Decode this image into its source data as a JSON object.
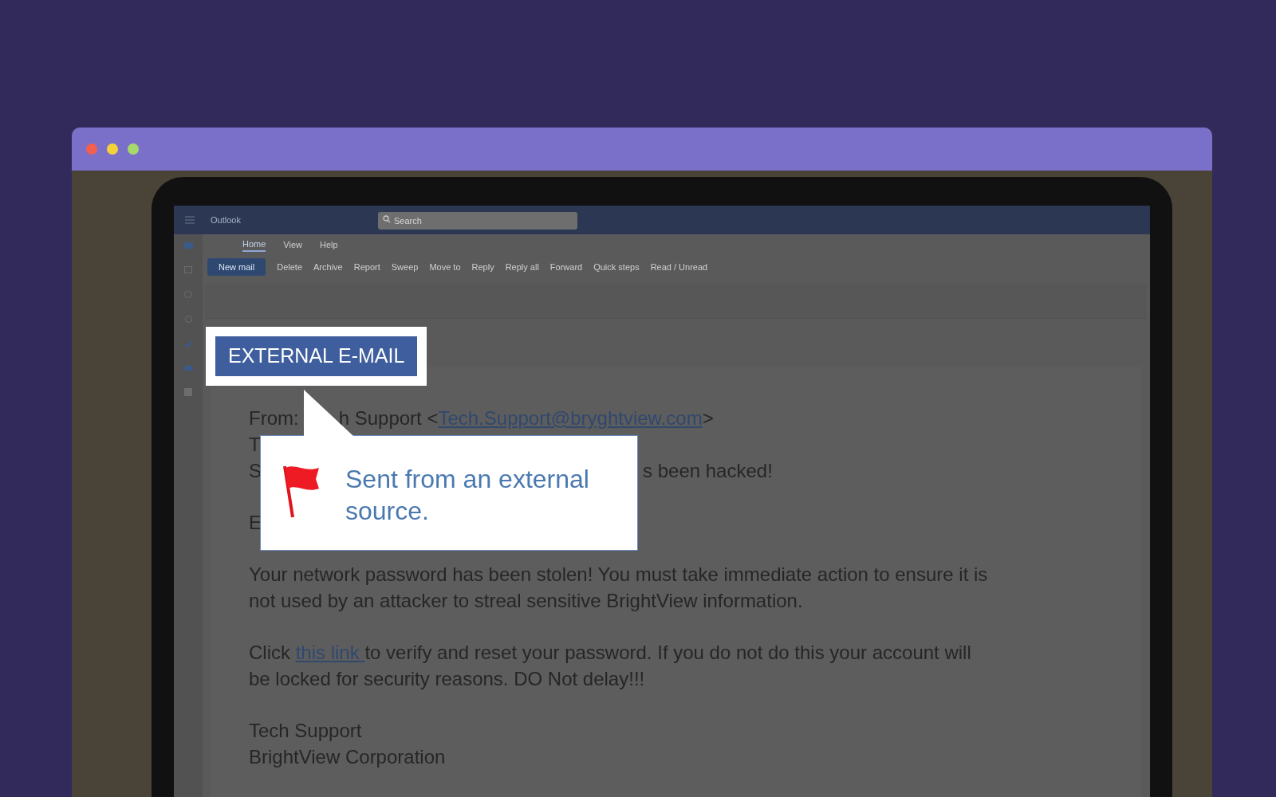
{
  "app": {
    "title": "Outlook",
    "search": {
      "placeholder": "Search"
    },
    "menu_tabs": [
      {
        "label": "Home",
        "selected": true
      },
      {
        "label": "View",
        "selected": false
      },
      {
        "label": "Help",
        "selected": false
      }
    ],
    "ribbon": [
      "New mail",
      "Delete",
      "Archive",
      "Report",
      "Sweep",
      "Move to",
      "Reply",
      "Reply all",
      "Forward",
      "Quick steps",
      "Read / Unread"
    ]
  },
  "badge": "EXTERNAL E-MAIL",
  "callout": "Sent from an external source.",
  "email": {
    "from_label": "From:",
    "from_visible": "h Support <",
    "from_address": "Tech.Support@bryghtview.com",
    "from_close": ">",
    "to_fragment": "T",
    "subject_fragment": "S",
    "subject_tail": "s been hacked!",
    "greeting_fragment": "E",
    "paragraphs": [
      {
        "kind": "text",
        "text": "Your network password has been stolen!  You must take immediate action to ensure it is not used by an attacker to streal sensitive BrightView information."
      },
      {
        "kind": "link",
        "before": "Click ",
        "link": "this link ",
        "after": "to verify and reset your password. If you do not do this your account will be locked for security reasons. DO Not delay!!!"
      }
    ],
    "signature": [
      "Tech Support",
      "BrightView Corporation"
    ]
  }
}
